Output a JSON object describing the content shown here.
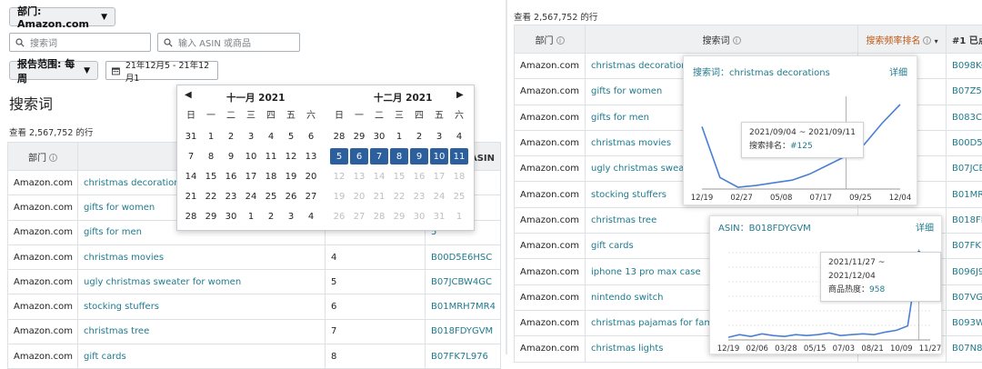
{
  "toolbar": {
    "dept_button": "部门: Amazon.com",
    "search_placeholder": "搜索词",
    "asin_placeholder": "输入 ASIN 或商品",
    "report_range_button": "报告范围: 每周",
    "date_range_value": "21年12月5 - 21年12月1"
  },
  "calendar": {
    "left_month": "十一月 2021",
    "right_month": "十二月 2021",
    "weekdays": [
      "日",
      "一",
      "二",
      "三",
      "四",
      "五",
      "六"
    ],
    "left_days": [
      {
        "d": "31",
        "s": "norm"
      },
      {
        "d": "1",
        "s": "norm"
      },
      {
        "d": "2",
        "s": "norm"
      },
      {
        "d": "3",
        "s": "norm"
      },
      {
        "d": "4",
        "s": "norm"
      },
      {
        "d": "5",
        "s": "norm"
      },
      {
        "d": "6",
        "s": "norm"
      },
      {
        "d": "7",
        "s": "norm"
      },
      {
        "d": "8",
        "s": "norm"
      },
      {
        "d": "9",
        "s": "norm"
      },
      {
        "d": "10",
        "s": "norm"
      },
      {
        "d": "11",
        "s": "norm"
      },
      {
        "d": "12",
        "s": "norm"
      },
      {
        "d": "13",
        "s": "norm"
      },
      {
        "d": "14",
        "s": "norm"
      },
      {
        "d": "15",
        "s": "norm"
      },
      {
        "d": "16",
        "s": "norm"
      },
      {
        "d": "17",
        "s": "norm"
      },
      {
        "d": "18",
        "s": "norm"
      },
      {
        "d": "19",
        "s": "norm"
      },
      {
        "d": "20",
        "s": "norm"
      },
      {
        "d": "21",
        "s": "norm"
      },
      {
        "d": "22",
        "s": "norm"
      },
      {
        "d": "23",
        "s": "norm"
      },
      {
        "d": "24",
        "s": "norm"
      },
      {
        "d": "25",
        "s": "norm"
      },
      {
        "d": "26",
        "s": "norm"
      },
      {
        "d": "27",
        "s": "norm"
      },
      {
        "d": "28",
        "s": "norm"
      },
      {
        "d": "29",
        "s": "norm"
      },
      {
        "d": "30",
        "s": "norm"
      },
      {
        "d": "1",
        "s": "norm"
      },
      {
        "d": "2",
        "s": "norm"
      },
      {
        "d": "3",
        "s": "norm"
      },
      {
        "d": "4",
        "s": "norm"
      }
    ],
    "right_days": [
      {
        "d": "28",
        "s": "norm"
      },
      {
        "d": "29",
        "s": "norm"
      },
      {
        "d": "30",
        "s": "norm"
      },
      {
        "d": "1",
        "s": "norm"
      },
      {
        "d": "2",
        "s": "norm"
      },
      {
        "d": "3",
        "s": "norm"
      },
      {
        "d": "4",
        "s": "norm"
      },
      {
        "d": "5",
        "s": "sel"
      },
      {
        "d": "6",
        "s": "sel"
      },
      {
        "d": "7",
        "s": "sel"
      },
      {
        "d": "8",
        "s": "sel"
      },
      {
        "d": "9",
        "s": "sel"
      },
      {
        "d": "10",
        "s": "sel"
      },
      {
        "d": "11",
        "s": "sel"
      },
      {
        "d": "12",
        "s": "dim"
      },
      {
        "d": "13",
        "s": "dim"
      },
      {
        "d": "14",
        "s": "dim"
      },
      {
        "d": "15",
        "s": "dim"
      },
      {
        "d": "16",
        "s": "dim"
      },
      {
        "d": "17",
        "s": "dim"
      },
      {
        "d": "18",
        "s": "dim"
      },
      {
        "d": "19",
        "s": "dim"
      },
      {
        "d": "20",
        "s": "dim"
      },
      {
        "d": "21",
        "s": "dim"
      },
      {
        "d": "22",
        "s": "dim"
      },
      {
        "d": "23",
        "s": "dim"
      },
      {
        "d": "24",
        "s": "dim"
      },
      {
        "d": "25",
        "s": "dim"
      },
      {
        "d": "26",
        "s": "dim"
      },
      {
        "d": "27",
        "s": "dim"
      },
      {
        "d": "28",
        "s": "dim"
      },
      {
        "d": "29",
        "s": "dim"
      },
      {
        "d": "30",
        "s": "dim"
      },
      {
        "d": "31",
        "s": "dim"
      },
      {
        "d": "1",
        "s": "dim"
      }
    ]
  },
  "left": {
    "section_title": "搜索词",
    "results_count": "查看 2,567,752 的行",
    "header_dept": "部门",
    "header_asin_partial": "击 ASIN",
    "rows": [
      {
        "dept": "Amazon.com",
        "term": "christmas decorations",
        "rank": "",
        "asin": "L"
      },
      {
        "dept": "Amazon.com",
        "term": "gifts for women",
        "rank": "",
        "asin": "4"
      },
      {
        "dept": "Amazon.com",
        "term": "gifts for men",
        "rank": "",
        "asin": "5"
      },
      {
        "dept": "Amazon.com",
        "term": "christmas movies",
        "rank": "4",
        "asin": "B00D5E6HSC"
      },
      {
        "dept": "Amazon.com",
        "term": "ugly christmas sweater for women",
        "rank": "5",
        "asin": "B07JCBW4GC"
      },
      {
        "dept": "Amazon.com",
        "term": "stocking stuffers",
        "rank": "6",
        "asin": "B01MRH7MR4"
      },
      {
        "dept": "Amazon.com",
        "term": "christmas tree",
        "rank": "7",
        "asin": "B018FDYGVM"
      },
      {
        "dept": "Amazon.com",
        "term": "gift cards",
        "rank": "8",
        "asin": "B07FK7L976"
      }
    ]
  },
  "right": {
    "results_count": "查看 2,567,752 的行",
    "header_dept": "部门",
    "header_term": "搜索词",
    "header_rank": "搜索频率排名",
    "header_asin": "#1 已点",
    "rows": [
      {
        "dept": "Amazon.com",
        "term": "christmas decorations",
        "asin": "B098KC"
      },
      {
        "dept": "Amazon.com",
        "term": "gifts for women",
        "asin": "B07Z5L"
      },
      {
        "dept": "Amazon.com",
        "term": "gifts for men",
        "asin": "B083C4"
      },
      {
        "dept": "Amazon.com",
        "term": "christmas movies",
        "asin": "B00D5E"
      },
      {
        "dept": "Amazon.com",
        "term": "ugly christmas sweater f",
        "asin": "B07JCB"
      },
      {
        "dept": "Amazon.com",
        "term": "stocking stuffers",
        "asin": "B01MRH"
      },
      {
        "dept": "Amazon.com",
        "term": "christmas tree",
        "asin": "B018FD"
      },
      {
        "dept": "Amazon.com",
        "term": "gift cards",
        "asin": "B07FK7"
      },
      {
        "dept": "Amazon.com",
        "term": "iphone 13 pro max case",
        "asin": "B096J9"
      },
      {
        "dept": "Amazon.com",
        "term": "nintendo switch",
        "asin": "B07VGR"
      },
      {
        "dept": "Amazon.com",
        "term": "christmas pajamas for family",
        "asin": "B093WR"
      },
      {
        "dept": "Amazon.com",
        "term": "christmas lights",
        "asin": "B07N8C"
      }
    ]
  },
  "popup1": {
    "label": "搜索词：",
    "term": "christmas decorations",
    "detail": "详细",
    "tooltip_range": "2021/09/04 ~ 2021/09/11",
    "tooltip_metric": "搜索排名：",
    "tooltip_value": "#125"
  },
  "popup2": {
    "label": "ASIN：",
    "asin": "B018FDYGVM",
    "detail": "详细",
    "tooltip_range": "2021/11/27 ~ 2021/12/04",
    "tooltip_metric": "商品热度：",
    "tooltip_value": "958"
  },
  "chart_data": [
    {
      "type": "line",
      "title": "",
      "x": [
        "12/19",
        "02/27",
        "05/08",
        "07/17",
        "09/25",
        "12/04"
      ],
      "series": [
        {
          "values": [
            0.7,
            0.13,
            0.02,
            0.04,
            0.07,
            0.1,
            0.17,
            0.27,
            0.37,
            0.5,
            0.74,
            0.95
          ]
        }
      ],
      "ylim": [
        0,
        1
      ],
      "grid": false,
      "color": "#4a7fd4"
    },
    {
      "type": "line",
      "title": "",
      "x": [
        "12/19",
        "02/06",
        "03/28",
        "05/15",
        "07/03",
        "08/21",
        "10/09",
        "11/27"
      ],
      "series": [
        {
          "values": [
            0.03,
            0.06,
            0.04,
            0.07,
            0.05,
            0.04,
            0.06,
            0.05,
            0.06,
            0.08,
            0.05,
            0.06,
            0.07,
            0.06,
            0.09,
            0.11,
            0.16,
            1.0,
            0.45
          ]
        }
      ],
      "ylim": [
        0,
        1
      ],
      "grid": true,
      "color": "#4a7fd4"
    }
  ],
  "colors": {
    "accent": "#1f7a8c",
    "selected": "#2c5f9e",
    "sort_header": "#c05a17",
    "line": "#4a7fd4"
  }
}
